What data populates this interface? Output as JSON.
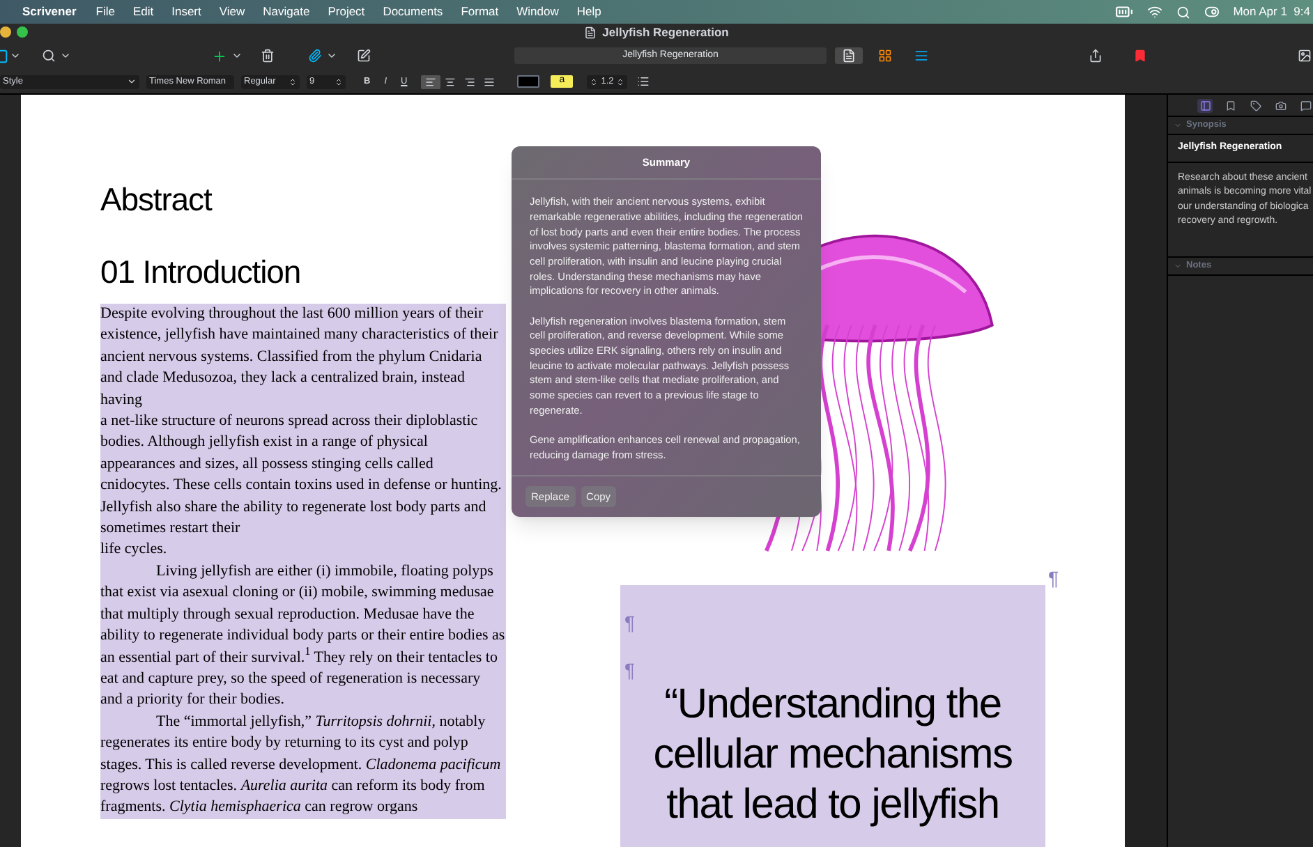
{
  "menu_bar": {
    "app": "Scrivener",
    "items": [
      "File",
      "Edit",
      "Insert",
      "View",
      "Navigate",
      "Project",
      "Documents",
      "Format",
      "Window",
      "Help"
    ],
    "clock": "Mon Apr 1  9:4"
  },
  "window": {
    "title": "Jellyfish Regeneration"
  },
  "toolbar": {
    "document_title": "Jellyfish Regeneration",
    "view_modes": [
      {
        "kind": "document",
        "selected": true
      },
      {
        "kind": "corkboard",
        "selected": false
      },
      {
        "kind": "outline",
        "selected": false
      }
    ]
  },
  "format_bar": {
    "style": "Style",
    "font": "Times New Roman",
    "weight": "Regular",
    "size": "9",
    "text_styles": [
      {
        "kind": "bold",
        "label": "B"
      },
      {
        "kind": "italic",
        "label": "I"
      },
      {
        "kind": "underline",
        "label": "U"
      }
    ],
    "alignments": [
      {
        "kind": "left",
        "selected": true
      },
      {
        "kind": "center",
        "selected": false
      },
      {
        "kind": "right",
        "selected": false
      },
      {
        "kind": "justify",
        "selected": false
      }
    ],
    "highlight_label": "a",
    "line_spacing": "1.2"
  },
  "document": {
    "headings": [
      "Abstract",
      "01 Introduction"
    ],
    "paragraphs": [
      {
        "indent": false,
        "text": "Despite evolving throughout the last 600 million years of their existence, jellyfish have maintained many characteristics of their ancient nervous systems. Classified from the phylum Cnidaria and clade Medusozoa, they lack a centralized brain, instead having"
      },
      {
        "indent": false,
        "text": "a net-like structure of neurons spread across their diploblastic bodies. Although jellyfish exist in a range of physical appearances and sizes, all possess stinging cells called cnidocytes. These cells contain toxins used in defense or hunting. Jellyfish also share the ability to regenerate lost body parts and sometimes restart their"
      },
      {
        "indent": false,
        "text": "life cycles."
      },
      {
        "indent": true,
        "text": "Living jellyfish are either (i) immobile, floating polyps that exist via asexual cloning or (ii) mobile, swimming medusae that multiply through sexual reproduction. Medusae have the ability to regenerate individual body parts or their entire bodies as an essential part of their survival.$^{1}$ They rely on their tentacles to eat and capture prey, so the speed of regeneration is necessary and a priority for their bodies."
      },
      {
        "indent": true,
        "text": "The “immortal jellyfish,” *Turritopsis dohrnii*, notably regenerates its entire body by returning to its cyst and polyp stages. This is called reverse development. *Cladonema pacificum* regrows lost tentacles. *Aurelia aurita* can reform its body from fragments. *Clytia hemisphaerica* can regrow organs"
      }
    ],
    "pilcrows": [
      "¶",
      "¶",
      "¶"
    ],
    "quote": "“Understanding the cellular mechanisms that lead to jellyfish"
  },
  "summary": {
    "title": "Summary",
    "paragraphs": [
      "Jellyfish, with their ancient nervous systems, exhibit remarkable regenerative abilities, including the regeneration of lost body parts and even their entire bodies. The process involves systemic patterning, blastema formation, and stem cell proliferation, with insulin and leucine playing crucial roles. Understanding these mechanisms may have implications for recovery in other animals.",
      "Jellyfish regeneration involves blastema formation, stem cell proliferation, and reverse development. While some species utilize ERK signaling, others rely on insulin and leucine to activate molecular pathways. Jellyfish possess stem and stem-like cells that mediate proliferation, and some species can revert to a previous life stage to regenerate.",
      "Gene amplification enhances cell renewal and propagation, reducing damage from stress."
    ],
    "buttons": [
      "Replace",
      "Copy"
    ]
  },
  "inspector": {
    "tabs": [
      {
        "kind": "synopsis",
        "selected": true
      },
      {
        "kind": "bookmark",
        "selected": false
      },
      {
        "kind": "tag",
        "selected": false
      },
      {
        "kind": "camera",
        "selected": false
      },
      {
        "kind": "comment",
        "selected": false
      }
    ],
    "sections": [
      {
        "title": "Synopsis",
        "expanded": true,
        "heading": "Jellyfish Regeneration",
        "text": "Research about these ancient\nanimals is becoming more vital\nour understanding of biologica\nrecovery and regrowth."
      },
      {
        "title": "Notes",
        "expanded": true
      }
    ]
  }
}
